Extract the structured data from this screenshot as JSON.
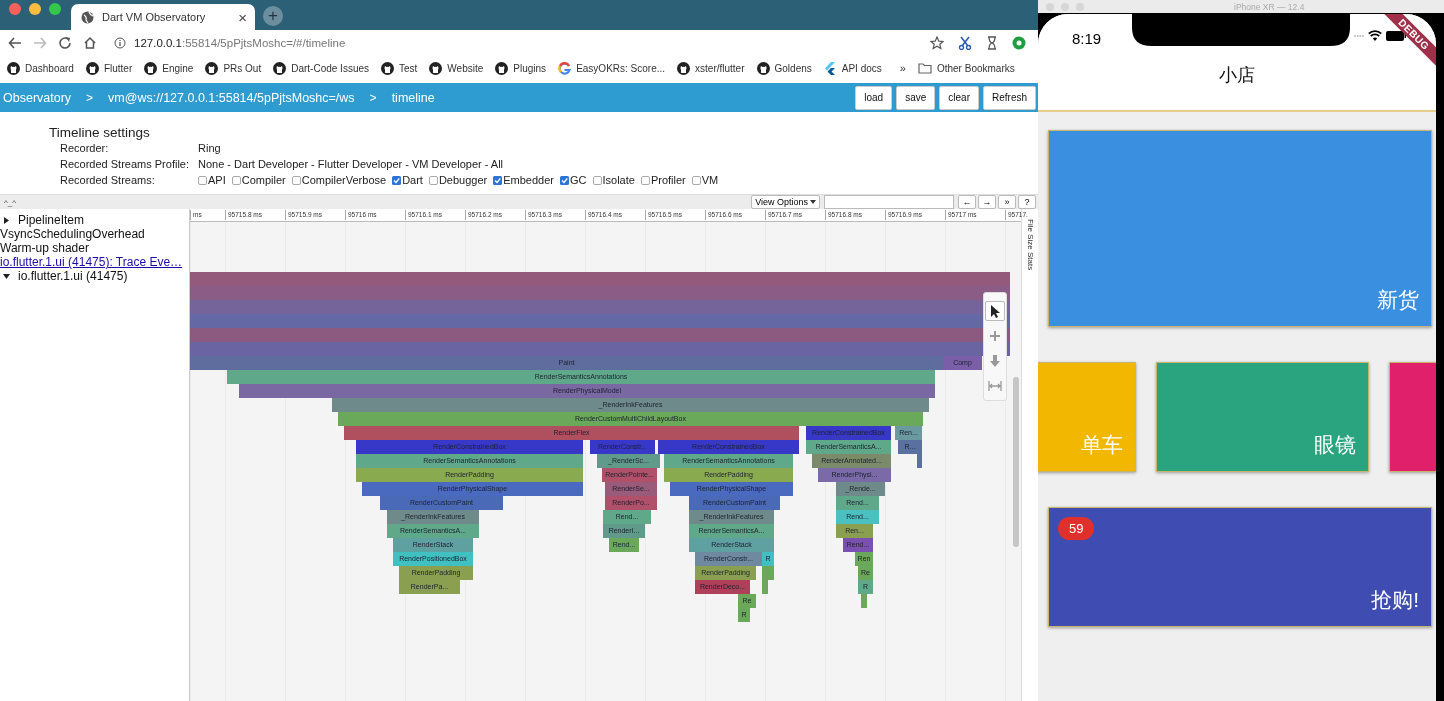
{
  "browser": {
    "tab": {
      "title": "Dart VM Observatory",
      "close": "×"
    },
    "new_tab": "+",
    "url": {
      "host": "127.0.0.1",
      "rest": ":55814/5pPjtsMoshc=/#/timeline"
    },
    "bookmarks": [
      {
        "label": "Dashboard",
        "kind": "github"
      },
      {
        "label": "Flutter",
        "kind": "github"
      },
      {
        "label": "Engine",
        "kind": "github"
      },
      {
        "label": "PRs Out",
        "kind": "github"
      },
      {
        "label": "Dart-Code Issues",
        "kind": "github"
      },
      {
        "label": "Test",
        "kind": "github"
      },
      {
        "label": "Website",
        "kind": "github"
      },
      {
        "label": "Plugins",
        "kind": "github"
      },
      {
        "label": "EasyOKRs: Score...",
        "kind": "google"
      },
      {
        "label": "xster/flutter",
        "kind": "github"
      },
      {
        "label": "Goldens",
        "kind": "github"
      },
      {
        "label": "API docs",
        "kind": "flutter"
      }
    ],
    "bookmarks_more": "»",
    "other_bookmarks": "Other Bookmarks"
  },
  "navbar": {
    "crumbs": [
      {
        "kind": "crumb",
        "text": "Observatory"
      },
      {
        "kind": "separator",
        "text": ">"
      },
      {
        "kind": "crumb",
        "text": "vm@ws://127.0.0.1:55814/5pPjtsMoshc=/ws"
      },
      {
        "kind": "separator",
        "text": ">"
      },
      {
        "kind": "crumb",
        "text": "timeline"
      }
    ],
    "buttons": [
      "load",
      "save",
      "clear",
      "Refresh"
    ]
  },
  "settings": {
    "title": "Timeline settings",
    "recorder": {
      "label": "Recorder:",
      "value": "Ring"
    },
    "profile": {
      "label": "Recorded Streams Profile:",
      "value": "None - Dart Developer - Flutter Developer - VM Developer - All"
    },
    "streams": {
      "label": "Recorded Streams:",
      "items": [
        {
          "name": "API",
          "checked": false
        },
        {
          "name": "Compiler",
          "checked": false
        },
        {
          "name": "CompilerVerbose",
          "checked": false
        },
        {
          "name": "Dart",
          "checked": true
        },
        {
          "name": "Debugger",
          "checked": false
        },
        {
          "name": "Embedder",
          "checked": true
        },
        {
          "name": "GC",
          "checked": true
        },
        {
          "name": "Isolate",
          "checked": false
        },
        {
          "name": "Profiler",
          "checked": false
        },
        {
          "name": "VM",
          "checked": false
        }
      ]
    }
  },
  "toolbar": {
    "toggle": "^_^",
    "view_options": "View Options",
    "buttons": [
      "←",
      "→",
      "»",
      "?"
    ]
  },
  "tracks": [
    {
      "label": "PipelineItem",
      "kind": "group",
      "expanded": false
    },
    {
      "label": "VsyncSchedulingOverhead",
      "kind": "plain"
    },
    {
      "label": "Warm-up shader",
      "kind": "plain"
    },
    {
      "label": "io.flutter.1.ui (41475): Trace Eve…",
      "kind": "link"
    },
    {
      "label": "io.flutter.1.ui (41475)",
      "kind": "group",
      "expanded": true
    }
  ],
  "ruler_ticks": [
    "ms",
    "95715.8 ms",
    "95715.9 ms",
    "95716 ms",
    "95716.1 ms",
    "95716.2 ms",
    "95716.3 ms",
    "95716.4 ms",
    "95716.5 ms",
    "95716.6 ms",
    "95716.7 ms",
    "95716.8 ms",
    "95716.9 ms",
    "95717 ms",
    "95717."
  ],
  "side_tab": "File Size Stats",
  "flame": [
    [
      {
        "color": "#935a7c"
      }
    ],
    [
      {
        "color": "#8a5c86"
      }
    ],
    [
      {
        "color": "#74649a"
      }
    ],
    [
      {
        "color": "#6468a4"
      }
    ],
    [
      {
        "color": "#8c5a80"
      }
    ],
    [
      {
        "color": "#6a64a2"
      }
    ],
    [
      {
        "label": "Paint",
        "color": "#5e6d9e"
      },
      {
        "label": "Comp",
        "color": "#7a5fa8"
      }
    ],
    [
      {
        "label": "RenderSemanticsAnnotations",
        "color": "#5fa88a"
      }
    ],
    [
      {
        "label": "RenderPhysicalModel",
        "color": "#7a68a2"
      }
    ],
    [
      {
        "label": "_RenderInkFeatures",
        "color": "#6f8a8a"
      }
    ],
    [
      {
        "label": "RenderCustomMultiChildLayoutBox",
        "color": "#6aa85a"
      }
    ],
    [
      {
        "label": "RenderFlex",
        "color": "#b0505e"
      },
      {
        "label": "RenderConstrainedBox",
        "color": "#3838c8"
      },
      {
        "label": "Ren...",
        "color": "#6a9aa0"
      }
    ],
    [
      {
        "label": "RenderConstrainedBox",
        "color": "#3838c8"
      },
      {
        "label": "RenderConstr...",
        "color": "#3838c8"
      },
      {
        "label": "RenderConstrainedBox",
        "color": "#3838c8"
      },
      {
        "label": "RenderSemanticsA...",
        "color": "#5fa88a"
      },
      {
        "label": "R...",
        "color": "#5a70a0"
      }
    ],
    [
      {
        "label": "RenderSemanticsAnnotations",
        "color": "#5fa88a"
      },
      {
        "label": "_RenderSc...",
        "color": "#5f9a8a"
      },
      {
        "label": "RenderSemanticsAnnotations",
        "color": "#5fa88a"
      },
      {
        "label": "RenderAnnotated...",
        "color": "#7a8a6a"
      },
      {
        "color": "#5a70a0"
      }
    ],
    [
      {
        "label": "RenderPadding",
        "color": "#8aaa50"
      },
      {
        "label": "RenderPointe...",
        "color": "#b0506a"
      },
      {
        "label": "RenderPadding",
        "color": "#8aaa50"
      },
      {
        "label": "RenderPhysi...",
        "color": "#7a6aa8"
      }
    ],
    [
      {
        "label": "RenderPhysicalShape",
        "color": "#4a6ac0"
      },
      {
        "label": "RenderSe...",
        "color": "#9a5a7a"
      },
      {
        "label": "RenderPhysicalShape",
        "color": "#4a6ac0"
      },
      {
        "label": "_Rende...",
        "color": "#6f8a8a"
      }
    ],
    [
      {
        "label": "RenderCustomPaint",
        "color": "#4a6ab8"
      },
      {
        "label": "RenderPo...",
        "color": "#b0506a"
      },
      {
        "label": "RenderCustomPaint",
        "color": "#4a6ab8"
      },
      {
        "label": "Rend...",
        "color": "#5fa88a"
      }
    ],
    [
      {
        "label": "_RenderInkFeatures",
        "color": "#6f8a8a"
      },
      {
        "label": "Rend...",
        "color": "#5fa88a"
      },
      {
        "label": "_RenderInkFeatures",
        "color": "#6f8a8a"
      },
      {
        "label": "Rend...",
        "color": "#4ac0c0"
      }
    ],
    [
      {
        "label": "RenderSemanticsA...",
        "color": "#5fa88a"
      },
      {
        "label": "RenderI...",
        "color": "#5f9a8a"
      },
      {
        "label": "RenderSemanticsA...",
        "color": "#5fa88a"
      },
      {
        "label": "Ren...",
        "color": "#8aa050"
      }
    ],
    [
      {
        "label": "RenderStack",
        "color": "#5fa0a0"
      },
      {
        "label": "Rend...",
        "color": "#6aa85a"
      },
      {
        "label": "RenderStack",
        "color": "#5fa0a0"
      },
      {
        "label": "Rend...",
        "color": "#7a50b0"
      }
    ],
    [
      {
        "label": "RenderPositionedBox",
        "color": "#40c0c0"
      },
      {
        "label": "RenderConstr...",
        "color": "#6f8aa0"
      },
      {
        "label": "R",
        "color": "#40c0c0"
      },
      {
        "label": "Ren",
        "color": "#6aa85a"
      }
    ],
    [
      {
        "label": "RenderPadding",
        "color": "#8aa050"
      },
      {
        "label": "RenderPadding",
        "color": "#8aa050"
      },
      {
        "color": "#6aa85a"
      },
      {
        "label": "Re",
        "color": "#6aa85a"
      }
    ],
    [
      {
        "label": "RenderPa...",
        "color": "#8aa050"
      },
      {
        "label": "RenderDeco...",
        "color": "#b0405a"
      },
      {
        "color": "#6aa85a"
      },
      {
        "label": "R",
        "color": "#5fa88a"
      }
    ],
    [
      {
        "label": "Re",
        "color": "#6aa85a"
      },
      {
        "color": "#6aa85a"
      }
    ],
    [
      {
        "label": "R",
        "color": "#6aa85a"
      }
    ]
  ],
  "simulator": {
    "title": "iPhone XR — 12.4",
    "time": "8:19",
    "debug_banner": "DEBUG",
    "app_title": "小店",
    "tiles": [
      [
        {
          "label": "新货",
          "color": "#3b8fe0"
        }
      ],
      [
        {
          "label": "单车",
          "color": "#f2b700"
        },
        {
          "label": "眼镜",
          "color": "#2aa47e"
        },
        {
          "color": "#e0206b"
        }
      ],
      [
        {
          "label": "抢购!",
          "color": "#3f4db3",
          "badge": "59"
        }
      ]
    ]
  }
}
